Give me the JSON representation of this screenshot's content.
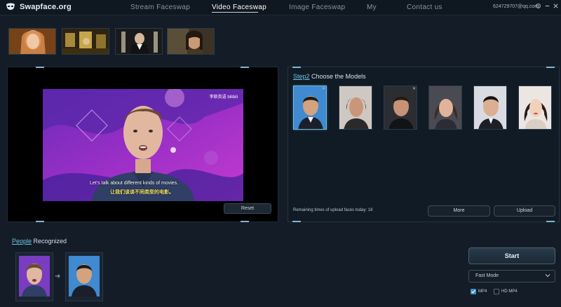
{
  "app": {
    "name": "Swapface.org"
  },
  "nav": {
    "items": [
      {
        "label": "Stream Faceswap"
      },
      {
        "label": "Video Faceswap"
      },
      {
        "label": "Image Faceswap"
      },
      {
        "label": "My"
      },
      {
        "label": "Contact us"
      }
    ],
    "active_index": 1,
    "account": "624729707@qq.com"
  },
  "thumbnails": {
    "icons": [
      "video-thumbnail-1",
      "video-thumbnail-2",
      "video-thumbnail-3",
      "video-thumbnail-4"
    ]
  },
  "video": {
    "subtitle_en": "Let's talk about different kinds of movies.",
    "subtitle_zh": "让我们谈谈不同类型的电影。",
    "watermark": "李斯英语 bilibili",
    "reset_label": "Reset"
  },
  "models": {
    "title_step": "Step2",
    "title_rest": " Choose the Models",
    "remaining_text": "Remaining times of upload faces today: 18",
    "more_label": "More",
    "upload_label": "Upload",
    "selected_index": 0
  },
  "people": {
    "title_hl": "People",
    "title_rest": " Recognized"
  },
  "controls": {
    "start_label": "Start",
    "mode_value": "Fast Mode",
    "mp4_label": "MP4",
    "mp4_checked": true,
    "hdmp4_label": "HD MP4",
    "hdmp4_checked": false
  },
  "colors": {
    "accent": "#6fc3ea",
    "background": "#141d27",
    "panel": "#111b25"
  }
}
